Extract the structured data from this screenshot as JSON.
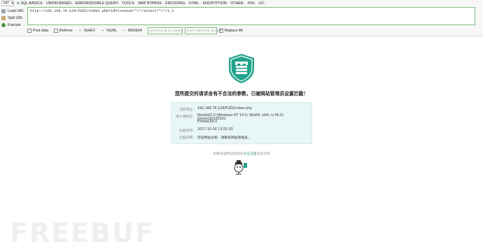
{
  "hackbar": {
    "select_value": "INT",
    "menu": [
      "SQL BASICS-",
      "UNION BASED-",
      "ERROR/DOUBLE QUERY-",
      "TOOLS-",
      "WAF BYPASS-",
      "ENCODING-",
      "HTML-",
      "ENCRYPTION-",
      "OTHER-",
      "XSS-",
      "LFI-"
    ],
    "load_url": "Load URL",
    "split_url": "Split URL",
    "execute": "Execute",
    "url_value": "http://192.168.79.128/FUZZ/index.php?id=1+union/*+*/select/*+*/1,2",
    "post_data": "Post data",
    "referrer": "Referrer",
    "hex": "0xHEX",
    "url_enc": "%URL",
    "base64": "BASE64",
    "insert_replace_placeholder": "insert string to replace",
    "insert_replacing_placeholder": "insert replacing string",
    "replace_all": "Replace All"
  },
  "page": {
    "headline": "您所提交的请求含有不合法的参数，已被网站管理员设置拦截！",
    "info": {
      "url_label": "当前网址：",
      "url_value": "192.168.79.128/FUZZ/index.php",
      "ua_label": "客户端特征：",
      "ua_value_1": "Mozilla/5.0 (Windows NT 10.0; Win64; x64; rv:56.0) Gecko/20100101",
      "ua_value_2": "Firefox/56.0",
      "time_label": "拦截时间：",
      "time_value": "2017-10-16 13:51:02",
      "note_label": "拦截说明：",
      "note_value": "欢迎网站访客，请联系网站管理员。"
    },
    "footnote_pre": "如果您是网站管理员",
    "footnote_link": "点击这里",
    "footnote_post": "查看详情",
    "watermark": "FREEBUF"
  }
}
